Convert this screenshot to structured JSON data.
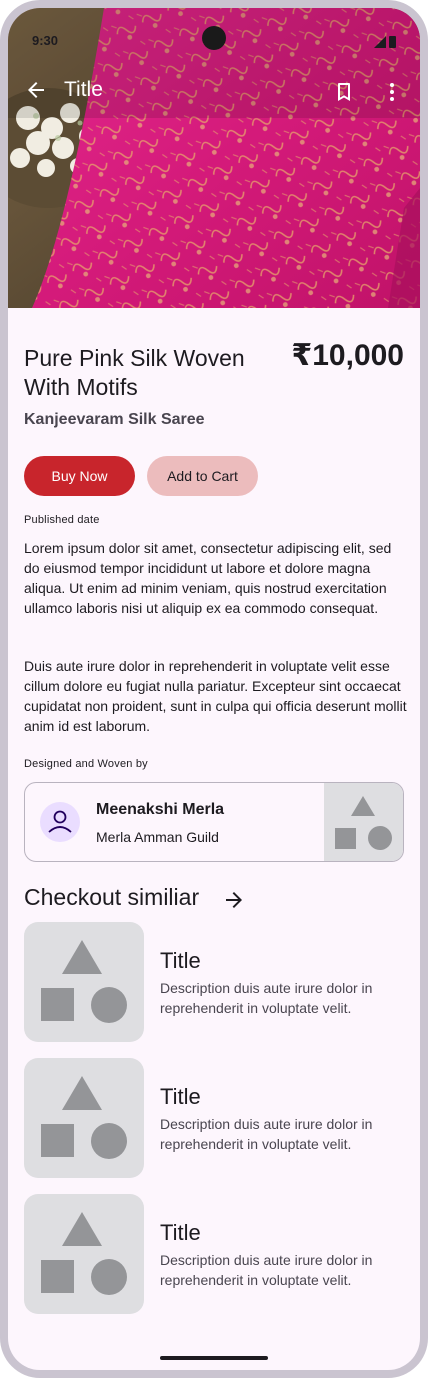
{
  "status_bar": {
    "time": "9:30"
  },
  "app_bar": {
    "title": "Title"
  },
  "product": {
    "name": "Pure Pink Silk Woven With Motifs",
    "price": "₹10,000",
    "subtitle": "Kanjeevaram Silk Saree"
  },
  "actions": {
    "buy_label": "Buy Now",
    "cart_label": "Add to Cart"
  },
  "published": {
    "label": "Published date",
    "paragraph1": "Lorem ipsum dolor sit amet, consectetur adipiscing elit, sed do eiusmod tempor incididunt ut labore et dolore magna aliqua. Ut enim ad minim veniam, quis nostrud exercitation ullamco laboris nisi ut aliquip ex ea commodo consequat.",
    "paragraph2": "Duis aute irure dolor in reprehenderit in voluptate velit esse cillum dolore eu fugiat nulla pariatur. Excepteur sint occaecat cupidatat non proident, sunt in culpa qui officia deserunt mollit anim id est laborum."
  },
  "designer": {
    "label": "Designed and Woven by",
    "name": "Meenakshi Merla",
    "guild": "Merla Amman Guild"
  },
  "similar": {
    "heading": "Checkout similiar",
    "items": [
      {
        "title": "Title",
        "description": "Description duis aute irure dolor in reprehenderit in voluptate velit."
      },
      {
        "title": "Title",
        "description": "Description duis aute irure dolor in reprehenderit in voluptate velit."
      },
      {
        "title": "Title",
        "description": "Description duis aute irure dolor in reprehenderit in voluptate velit."
      }
    ]
  },
  "colors": {
    "accent": "#c8252c",
    "tonal": "#ecbcbd",
    "saree": "#d61f7f",
    "background": "#fdf6fd"
  },
  "icons": [
    "arrow-back-icon",
    "bookmark-icon",
    "more-vert-icon",
    "person-icon",
    "arrow-forward-icon",
    "shapes-placeholder-icon"
  ]
}
